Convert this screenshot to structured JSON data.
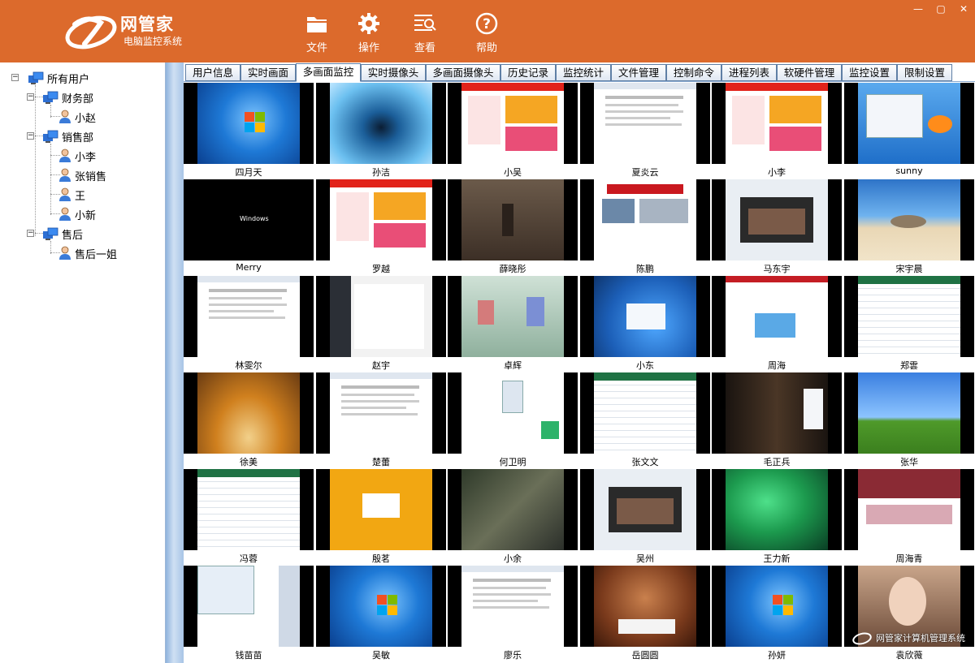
{
  "app": {
    "name": "网管家",
    "subtitle": "电脑监控系统"
  },
  "toolbar": [
    {
      "label": "文件",
      "icon": "folder-icon"
    },
    {
      "label": "操作",
      "icon": "gear-icon"
    },
    {
      "label": "查看",
      "icon": "view-icon"
    },
    {
      "label": "帮助",
      "icon": "help-icon"
    }
  ],
  "window_controls": {
    "minimize": "—",
    "maximize": "▢",
    "close": "✕"
  },
  "tree": {
    "root": "所有用户",
    "groups": [
      {
        "label": "财务部",
        "users": [
          "小赵"
        ]
      },
      {
        "label": "销售部",
        "users": [
          "小李",
          "张销售",
          "王",
          "小新"
        ]
      },
      {
        "label": "售后",
        "users": [
          "售后一姐"
        ]
      }
    ]
  },
  "tabs": [
    "用户信息",
    "实时画面",
    "多画面监控",
    "实时摄像头",
    "多画面摄像头",
    "历史记录",
    "监控统计",
    "文件管理",
    "控制命令",
    "进程列表",
    "软硬件管理",
    "监控设置",
    "限制设置"
  ],
  "active_tab": "多画面监控",
  "screens": [
    {
      "name": "四月天",
      "theme": "win7"
    },
    {
      "name": "孙洁",
      "theme": "water"
    },
    {
      "name": "小吴",
      "theme": "shop"
    },
    {
      "name": "夏炎云",
      "theme": "doc"
    },
    {
      "name": "小李",
      "theme": "shop"
    },
    {
      "name": "sunny",
      "theme": "fish"
    },
    {
      "name": "Merry",
      "theme": "winboot"
    },
    {
      "name": "罗越",
      "theme": "shop"
    },
    {
      "name": "薛晓彤",
      "theme": "game"
    },
    {
      "name": "陈鹏",
      "theme": "news"
    },
    {
      "name": "马东宇",
      "theme": "video"
    },
    {
      "name": "宋宇晨",
      "theme": "beach"
    },
    {
      "name": "林雯尔",
      "theme": "doc"
    },
    {
      "name": "赵宇",
      "theme": "chat"
    },
    {
      "name": "卓辉",
      "theme": "fantasy"
    },
    {
      "name": "小东",
      "theme": "login"
    },
    {
      "name": "周海",
      "theme": "web"
    },
    {
      "name": "郑雲",
      "theme": "sheet"
    },
    {
      "name": "徐美",
      "theme": "autumn"
    },
    {
      "name": "楚蕾",
      "theme": "doc"
    },
    {
      "name": "何卫明",
      "theme": "dialog"
    },
    {
      "name": "张文文",
      "theme": "sheet"
    },
    {
      "name": "毛正兵",
      "theme": "movie"
    },
    {
      "name": "张华",
      "theme": "xp"
    },
    {
      "name": "冯蓉",
      "theme": "sheet"
    },
    {
      "name": "殷茗",
      "theme": "win8"
    },
    {
      "name": "小余",
      "theme": "gamemap"
    },
    {
      "name": "吴州",
      "theme": "video"
    },
    {
      "name": "王力新",
      "theme": "leaves"
    },
    {
      "name": "周海青",
      "theme": "portal"
    },
    {
      "name": "钱苗苗",
      "theme": "explorer"
    },
    {
      "name": "吴敏",
      "theme": "win7"
    },
    {
      "name": "廖乐",
      "theme": "doc"
    },
    {
      "name": "岳圆圆",
      "theme": "cards"
    },
    {
      "name": "孙妍",
      "theme": "win7"
    },
    {
      "name": "袁欣薇",
      "theme": "portrait"
    }
  ],
  "watermark": "网管家计算机管理系统"
}
